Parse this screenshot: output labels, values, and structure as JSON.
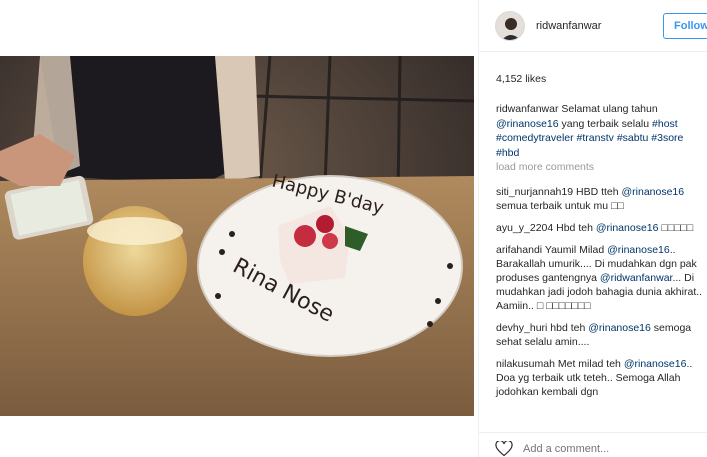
{
  "post": {
    "username": "ridwanfanwar",
    "follow_label": "Follow",
    "likes": "4,152 likes"
  },
  "caption": {
    "username": "ridwanfanwar",
    "text_1": " Selamat ulang tahun ",
    "mention": "@rinanose16",
    "text_2": " yang terbaik selalu ",
    "tag_host": "#host",
    "tag_comedytraveler": "#comedytraveler",
    "tag_transtv": "#transtv",
    "tag_sabtu": "#sabtu",
    "tag_3sore": "#3sore",
    "tag_hbd": "#hbd"
  },
  "load_more": "load more comments",
  "comments": [
    {
      "user": "siti_nurjannah19",
      "pre": " HBD tteh ",
      "mention": "@rinanose16",
      "post": " semua terbaik untuk mu □□"
    },
    {
      "user": "ayu_y_2204",
      "pre": " Hbd teh ",
      "mention": "@rinanose16",
      "post": " □□□□□"
    },
    {
      "user": "arifahandi",
      "pre": " Yaumil Milad ",
      "mention": "@rinanose16",
      "mid": ".. Barakallah umurik.... Di mudahkan dgn pak produses gantengnya ",
      "mention2": "@ridwanfanwar",
      "post": "... Di mudahkan jadi jodoh bahagia dunia akhirat.. Aamiin.. □ □□□□□□□"
    },
    {
      "user": "devhy_huri",
      "pre": " hbd teh ",
      "mention": "@rinanose16",
      "post": " semoga sehat selalu amin...."
    },
    {
      "user": "nilakusumah",
      "pre": " Met milad teh ",
      "mention": "@rinanose16",
      "post": ".. Doa yg terbaik utk teteh.. Semoga Allah jodohkan kembali dgn"
    }
  ],
  "add_comment_placeholder": "Add a comment...",
  "photo": {
    "plate_text_top": "Happy B'day",
    "plate_text_bottom": "Rina Nose"
  }
}
